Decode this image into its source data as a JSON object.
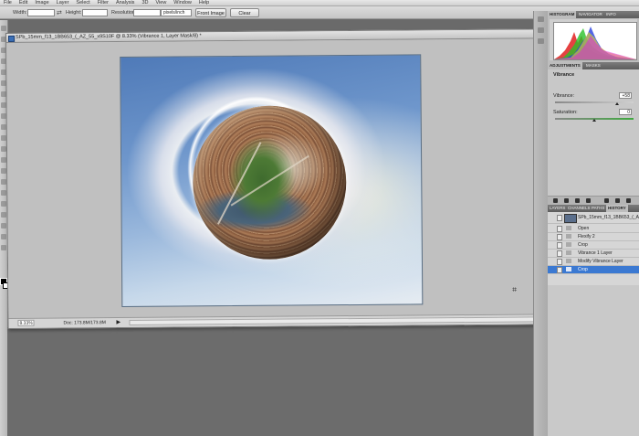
{
  "menu": [
    "File",
    "Edit",
    "Image",
    "Layer",
    "Select",
    "Filter",
    "Analysis",
    "3D",
    "View",
    "Window",
    "Help"
  ],
  "options": {
    "width_label": "Width:",
    "height_label": "Height:",
    "resolution_label": "Resolution:",
    "units": "pixels/inch",
    "front_image": "Front Image",
    "clear": "Clear",
    "swap_glyph": "⇄"
  },
  "document": {
    "title": "SPb_15mm_f13_1BB653_(_AZ_55_x9S10F @ 8.33% (Vibrance 1, Layer Mask/8) *",
    "zoom": "8.33%",
    "doc_size": "Doc: 173.8M/173.8M",
    "status_arrow": "▶",
    "crop_glyph": "⌗"
  },
  "panels": {
    "top_tabs": [
      "HISTOGRAM",
      "NAVIGATOR",
      "INFO"
    ],
    "adjust_tabs": [
      "ADJUSTMENTS",
      "MASKS"
    ],
    "adjustments": {
      "title": "Vibrance",
      "vibrance_label": "Vibrance:",
      "vibrance_value": "+58",
      "vibrance_level": 0.79,
      "saturation_label": "Saturation:",
      "saturation_value": "0",
      "saturation_level": 0.5
    },
    "history_tabs": [
      "LAYERS",
      "CHANNELS",
      "PATHS",
      "HISTORY"
    ],
    "history": {
      "snapshot": "SPb_15mm_f13_1BB653_(_AZ...",
      "steps": [
        "Open",
        "Flexify 2",
        "Crop",
        "Vibrance 1 Layer",
        "Modify Vibrance Layer",
        "Crop"
      ],
      "selected_index": 5
    }
  },
  "colors": {
    "selection": "#3b79d2",
    "panel_bg": "#bdbdbd",
    "workspace": "#6c6c6c"
  }
}
